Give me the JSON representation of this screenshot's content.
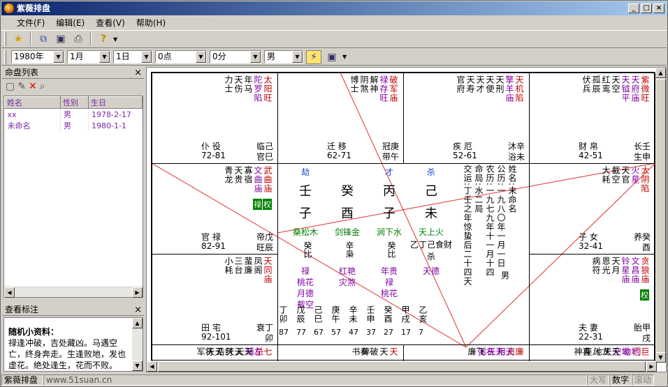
{
  "title": "紫薇排盘",
  "window_buttons": [
    "_",
    "□",
    "×"
  ],
  "menu": [
    "文件(F)",
    "编辑(E)",
    "查看(V)",
    "帮助(H)"
  ],
  "toolbar_icons": [
    "star-icon",
    "copy-icon",
    "save-icon",
    "print-icon",
    "help-icon"
  ],
  "selectors": {
    "year": "1980年",
    "month": "1月",
    "day": "1日",
    "hour": "0点",
    "minute": "0分",
    "gender": "男"
  },
  "list_pane": {
    "title": "命盘列表",
    "close": "×",
    "columns": [
      "姓名",
      "性别",
      "生日"
    ],
    "rows": [
      [
        "xx",
        "男",
        "1978-2-17"
      ],
      [
        "未命名",
        "男",
        "1980-1-1"
      ]
    ]
  },
  "note_pane": {
    "title": "查看标注",
    "close": "×",
    "heading": "随机小资料：",
    "text": "禄逢冲破，吉处藏凶。马遇空亡，终身奔走。生逢败地，发也虚花。绝处逢生，花而不败。"
  },
  "palaces": [
    {
      "id": "p1",
      "cols": [
        {
          "t": "太阳旺",
          "c": "red2"
        },
        {
          "t": "陀罗陷",
          "c": "purple"
        },
        {
          "t": "年马",
          "c": "k"
        },
        {
          "t": "天伤",
          "c": "k"
        },
        {
          "t": "力士",
          "c": "k"
        }
      ],
      "name": "仆 役",
      "range": "72-81",
      "stem": "临己",
      "stem2": "官巳"
    },
    {
      "id": "p2",
      "cols": [
        {
          "t": "破军庙",
          "c": "red"
        },
        {
          "t": "禄存旺",
          "c": "purple"
        },
        {
          "t": "解神",
          "c": "k"
        },
        {
          "t": "阴煞",
          "c": "k"
        },
        {
          "t": "博士",
          "c": "k"
        }
      ],
      "name": "迁 移",
      "range": "62-71",
      "stem": "冠庚",
      "stem2": "带午"
    },
    {
      "id": "p3",
      "cols": [
        {
          "t": "天机陷",
          "c": "red"
        },
        {
          "t": "擎羊庙",
          "c": "purple"
        },
        {
          "t": "天刑",
          "c": "k"
        },
        {
          "t": "天使",
          "c": "k"
        },
        {
          "t": "天才",
          "c": "k"
        },
        {
          "t": "天寿",
          "c": "k"
        },
        {
          "t": "官府",
          "c": "k"
        }
      ],
      "name": "疾 厄",
      "range": "52-61",
      "stem": "沐辛",
      "stem2": "浴未"
    },
    {
      "id": "p4",
      "cols": [
        {
          "t": "紫微旺",
          "c": "red"
        },
        {
          "t": "天府庙",
          "c": "purple"
        },
        {
          "t": "天钺平",
          "c": "purple"
        },
        {
          "t": "天空",
          "c": "k"
        },
        {
          "t": "红鸾",
          "c": "k"
        },
        {
          "t": "孤辰",
          "c": "k"
        },
        {
          "t": "伏兵",
          "c": "k"
        }
      ],
      "name": "财 帛",
      "range": "42-51",
      "stem": "长壬",
      "stem2": "生申"
    },
    {
      "id": "p5",
      "cols": [
        {
          "t": "武曲庙",
          "c": "red"
        },
        {
          "t": "文曲庙",
          "c": "purple"
        },
        {
          "t": "寡宿",
          "c": "k"
        },
        {
          "t": "天贵",
          "c": "k"
        },
        {
          "t": "青龙",
          "c": "k"
        }
      ],
      "name": "官 禄",
      "range": "82-91",
      "stem": "帝戊",
      "stem2": "旺辰",
      "hua": [
        "权",
        "禄"
      ]
    },
    {
      "id": "p6",
      "cols": [
        {
          "t": "太阴陷",
          "c": "red"
        },
        {
          "t": "火星",
          "c": "purple"
        },
        {
          "t": "天官",
          "c": "k"
        },
        {
          "t": "截空",
          "c": "k"
        },
        {
          "t": "大耗",
          "c": "k"
        }
      ],
      "name": "子 女",
      "range": "32-41",
      "stem": "养癸",
      "stem2": "酉"
    },
    {
      "id": "p7",
      "cols": [
        {
          "t": "天同庙",
          "c": "red"
        },
        {
          "t": "凤阁",
          "c": "k"
        },
        {
          "t": "蜚廉",
          "c": "k"
        },
        {
          "t": "三台",
          "c": "k"
        },
        {
          "t": "小耗",
          "c": "k"
        }
      ],
      "name": "田 宅",
      "range": "92-101",
      "stem": "衰丁",
      "stem2": "卯"
    },
    {
      "id": "p8",
      "cols": [
        {
          "t": "贪狼庙",
          "c": "red"
        },
        {
          "t": "文昌庙",
          "c": "purple"
        },
        {
          "t": "铃星庙",
          "c": "purple"
        },
        {
          "t": "天月",
          "c": "k"
        },
        {
          "t": "恩光",
          "c": "k"
        },
        {
          "t": "病符",
          "c": "k"
        }
      ],
      "name": "夫 妻",
      "range": "22-31",
      "stem": "胎甲",
      "stem2": "戌",
      "hua": [
        "权"
      ]
    },
    {
      "id": "p9",
      "cols": [
        {
          "t": "七杀",
          "c": "red"
        },
        {
          "t": "左辅",
          "c": "purple"
        },
        {
          "t": "天天",
          "c": "k"
        },
        {
          "t": "天天",
          "c": "k"
        },
        {
          "t": "封诰",
          "c": "k"
        },
        {
          "t": "天天",
          "c": "k"
        },
        {
          "t": "将军",
          "c": "k"
        }
      ]
    },
    {
      "id": "p10",
      "cols": [
        {
          "t": "天",
          "c": "red"
        },
        {
          "t": "天",
          "c": "k"
        },
        {
          "t": "破碎",
          "c": "k"
        },
        {
          "t": "奏书",
          "c": "k"
        }
      ]
    },
    {
      "id": "p11",
      "cols": [
        {
          "t": "廉贞",
          "c": "red"
        },
        {
          "t": "天相",
          "c": "purple"
        },
        {
          "t": "天天",
          "c": "purple"
        },
        {
          "t": "右弼",
          "c": "purple"
        },
        {
          "t": "飞廉",
          "c": "k"
        }
      ]
    },
    {
      "id": "p12",
      "cols": [
        {
          "t": "巨门",
          "c": "red"
        },
        {
          "t": "地劫",
          "c": "purple"
        },
        {
          "t": "地空",
          "c": "purple"
        },
        {
          "t": "天天",
          "c": "k"
        },
        {
          "t": "龙池",
          "c": "k"
        },
        {
          "t": "八座",
          "c": "k"
        },
        {
          "t": "喜神",
          "c": "k"
        }
      ]
    }
  ],
  "center": {
    "tags": [
      "劫",
      "才",
      "杀"
    ],
    "stems": [
      "壬",
      "癸",
      "丙",
      "己"
    ],
    "branches": [
      "子",
      "酉",
      "子",
      "未"
    ],
    "nayin": [
      "桑松木",
      "剑锋金",
      "涧下水",
      "天上火"
    ],
    "hidden": [
      "癸比",
      "辛枭",
      "癸比",
      "乙丁己食财杀"
    ],
    "stars_a": [
      "禄",
      "红艳",
      "年贵",
      "天德"
    ],
    "stars_b": [
      "桃花",
      "灾煞",
      "禄",
      ""
    ],
    "stars_c": [
      "月德",
      "",
      "桃花",
      ""
    ],
    "stars_d": [
      "截空",
      "",
      "",
      ""
    ],
    "info_cols": [
      "姓名:未命名",
      "公历:一九八〇年一月一日",
      "农历:一九七九年十一月十四",
      "命局:水二局",
      "交运:丁壬之年惊蛰后二十四天"
    ],
    "gender": "男",
    "dayun": [
      {
        "g": "丁卯",
        "n": "87"
      },
      {
        "g": "戊辰",
        "n": "77"
      },
      {
        "g": "己巳",
        "n": "67"
      },
      {
        "g": "庚午",
        "n": "57"
      },
      {
        "g": "辛未",
        "n": "47"
      },
      {
        "g": "壬申",
        "n": "37"
      },
      {
        "g": "癸酉",
        "n": "27"
      },
      {
        "g": "甲戌",
        "n": "17"
      },
      {
        "g": "乙亥",
        "n": "7"
      }
    ]
  },
  "status": {
    "app": "紫薇排盘",
    "url": "www.51suan.cn",
    "caps": "大写",
    "num": "数字",
    "scroll": "滚动"
  }
}
